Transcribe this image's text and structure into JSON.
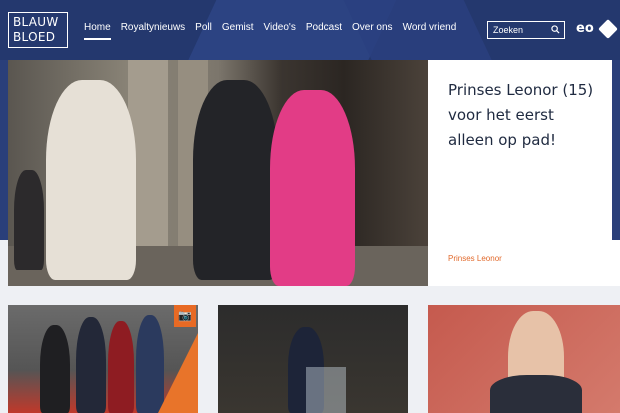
{
  "brand": {
    "logo_line1": "BLAUW",
    "logo_line2": "BLOED"
  },
  "nav": {
    "items": [
      {
        "label": "Home",
        "active": true
      },
      {
        "label": "Royaltynieuws"
      },
      {
        "label": "Poll"
      },
      {
        "label": "Gemist"
      },
      {
        "label": "Video's"
      },
      {
        "label": "Podcast"
      },
      {
        "label": "Over ons"
      },
      {
        "label": "Word vriend"
      }
    ]
  },
  "search": {
    "placeholder": "Zoeken",
    "icon": "search-icon"
  },
  "broadcaster": {
    "label": "eo"
  },
  "hero": {
    "title": "Prinses Leonor (15) voor het eerst alleen op pad!",
    "tag": "Prinses Leonor"
  },
  "cards": [
    {
      "icon": "camera-icon"
    },
    {},
    {}
  ],
  "colors": {
    "header_bg": "#24386e",
    "accent": "#e26a2c"
  }
}
